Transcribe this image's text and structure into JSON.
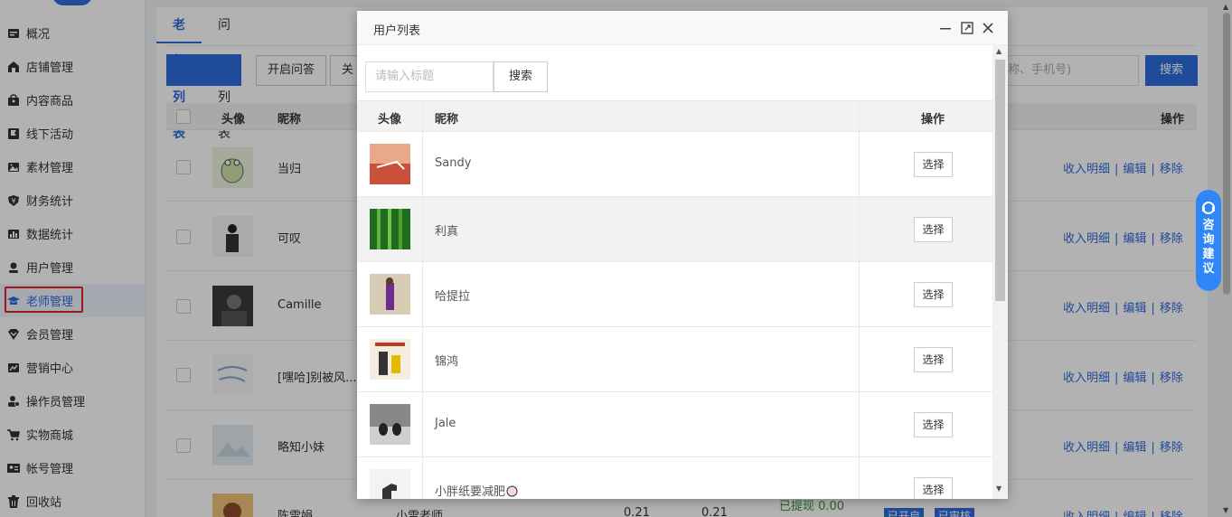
{
  "sidebar": {
    "items": [
      {
        "label": "概况",
        "icon": "dashboard-icon"
      },
      {
        "label": "店铺管理",
        "icon": "shop-icon"
      },
      {
        "label": "内容商品",
        "icon": "bag-icon"
      },
      {
        "label": "线下活动",
        "icon": "flag-icon"
      },
      {
        "label": "素材管理",
        "icon": "image-icon"
      },
      {
        "label": "财务统计",
        "icon": "yen-shield-icon"
      },
      {
        "label": "数据统计",
        "icon": "bar-chart-icon"
      },
      {
        "label": "用户管理",
        "icon": "user-icon"
      },
      {
        "label": "老师管理",
        "icon": "graduation-cap-icon",
        "active": true
      },
      {
        "label": "会员管理",
        "icon": "vip-icon"
      },
      {
        "label": "营销中心",
        "icon": "trend-icon"
      },
      {
        "label": "操作员管理",
        "icon": "operator-icon"
      },
      {
        "label": "实物商城",
        "icon": "cart-icon"
      },
      {
        "label": "帐号管理",
        "icon": "id-card-icon"
      },
      {
        "label": "回收站",
        "icon": "trash-icon"
      }
    ]
  },
  "background": {
    "tabs": [
      {
        "label": "老师列表",
        "active": true
      },
      {
        "label": "问题列表"
      }
    ],
    "toolbar": {
      "enable_qa": "开启问答",
      "close_partial": "关"
    },
    "search_placeholder": "(昵称、手机号)",
    "search_button": "搜索",
    "table_headers": {
      "avatar": "头像",
      "nickname": "昵称",
      "actions": "操作"
    },
    "rows": [
      {
        "nickname": "当归"
      },
      {
        "nickname": "可叹"
      },
      {
        "nickname": "Camille"
      },
      {
        "nickname": "[嘿哈]别被风..."
      },
      {
        "nickname": "略知小妹"
      },
      {
        "nickname": "陈雪娟",
        "extra": "小雪老师",
        "v1": "0.21",
        "v2": "0.21",
        "badges": [
          "已开启",
          "已审核"
        ]
      }
    ],
    "row_actions": {
      "income": "收入明细",
      "edit": "编辑",
      "remove": "移除",
      "sep": "|"
    },
    "partial_status": "已提现 0.00"
  },
  "float_tab": {
    "chars": [
      "咨",
      "询",
      "建",
      "议"
    ]
  },
  "modal": {
    "title": "用户列表",
    "search_placeholder": "请输入标题",
    "search_button": "搜索",
    "headers": {
      "avatar": "头像",
      "nickname": "昵称",
      "actions": "操作"
    },
    "select_label": "选择",
    "rows": [
      {
        "nickname": "Sandy"
      },
      {
        "nickname": "利真"
      },
      {
        "nickname": "哈提拉"
      },
      {
        "nickname": "锦鸿"
      },
      {
        "nickname": "Jale"
      },
      {
        "nickname": "小胖纸要减肥"
      }
    ]
  },
  "colors": {
    "accent": "#2f6bdd",
    "highlight_border": "#e3242b",
    "float_tab": "#2f86f6"
  }
}
